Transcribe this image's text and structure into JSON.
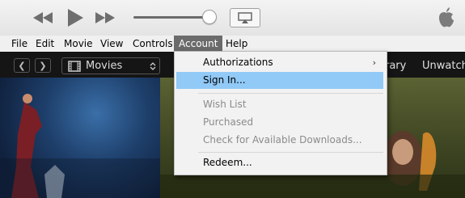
{
  "menubar": {
    "items": [
      {
        "label": "File"
      },
      {
        "label": "Edit"
      },
      {
        "label": "Movie"
      },
      {
        "label": "View"
      },
      {
        "label": "Controls"
      },
      {
        "label": "Account"
      },
      {
        "label": "Help"
      }
    ],
    "active_index": 5
  },
  "navbar": {
    "media_selector": "Movies",
    "tabs_partial": [
      "rary",
      "Unwatch"
    ]
  },
  "account_menu": {
    "items": [
      {
        "label": "Authorizations",
        "state": "submenu"
      },
      {
        "label": "Sign In...",
        "state": "highlighted"
      },
      {
        "label": "Wish List",
        "state": "disabled"
      },
      {
        "label": "Purchased",
        "state": "disabled"
      },
      {
        "label": "Check for Available Downloads...",
        "state": "disabled"
      },
      {
        "label": "Redeem...",
        "state": "enabled"
      }
    ]
  },
  "colors": {
    "menu_highlight": "#91c9f7",
    "active_menu": "#6b6b6b",
    "dark_nav": "#151515"
  }
}
